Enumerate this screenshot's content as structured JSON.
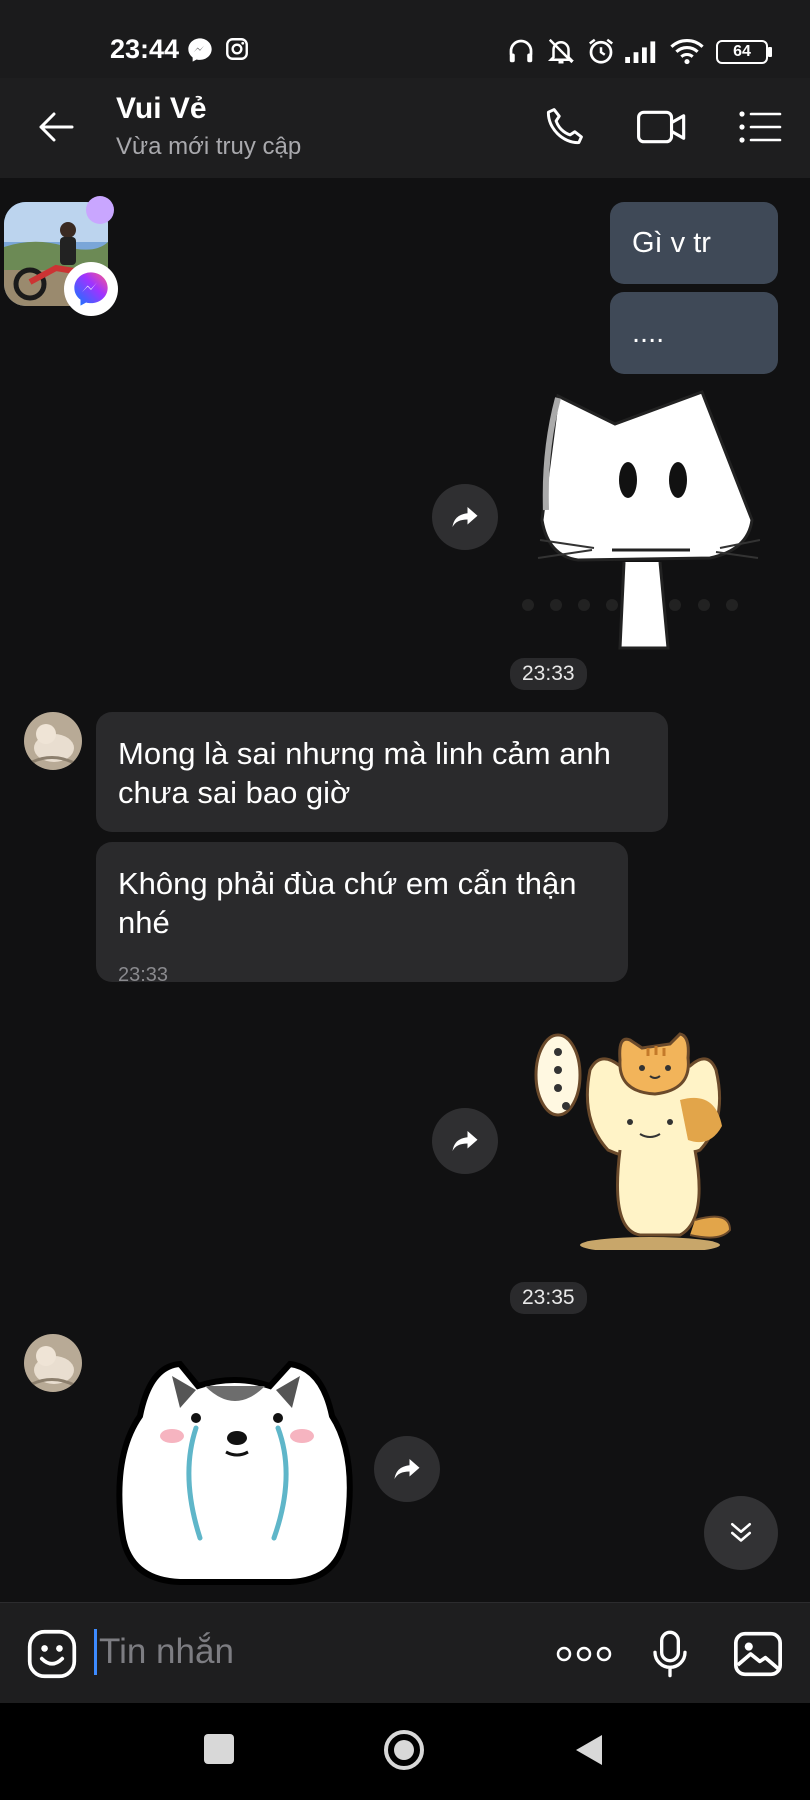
{
  "status_bar": {
    "time": "23:44",
    "battery": "64",
    "icons": [
      "messenger-icon",
      "instagram-icon",
      "headphones-icon",
      "bell-off-icon",
      "alarm-icon",
      "signal-icon",
      "wifi-icon",
      "battery-icon"
    ]
  },
  "header": {
    "contact_name": "Vui Vẻ",
    "status": "Vừa mới truy cập",
    "actions": [
      "back-icon",
      "phone-icon",
      "video-icon",
      "menu-icon"
    ]
  },
  "messages": {
    "out_1": "Gì v tr",
    "out_2": "....",
    "time_1": "23:33",
    "in_1": "Mong là sai nhưng mà linh cảm anh chưa sai bao giờ",
    "in_2": "Không phải đùa chứ em cẩn thận nhé",
    "in_2_time": "23:33",
    "time_2": "23:35"
  },
  "input": {
    "placeholder": "Tin nhắn",
    "icons": [
      "emoji-icon",
      "more-icon",
      "microphone-icon",
      "gallery-icon"
    ]
  },
  "colors": {
    "background": "#111112",
    "outgoing_bubble": "#3f4957",
    "incoming_bubble": "#2a2a2c",
    "caret": "#3d8bff",
    "presence_dot": "#c9a6ff"
  }
}
